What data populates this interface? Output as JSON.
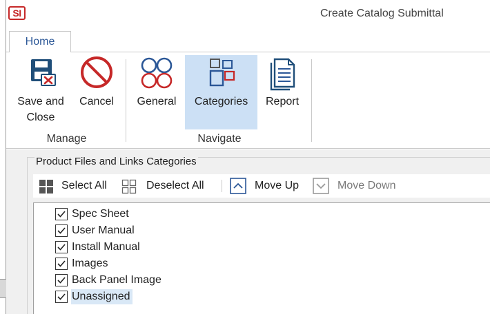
{
  "app": {
    "logo_text": "SI",
    "title": "Create Catalog Submittal"
  },
  "ribbon": {
    "tabs": [
      {
        "label": "Home"
      }
    ],
    "groups": {
      "manage": {
        "label": "Manage",
        "buttons": {
          "save_close": {
            "line1": "Save and",
            "line2": "Close"
          },
          "cancel": {
            "label": "Cancel"
          }
        }
      },
      "navigate": {
        "label": "Navigate",
        "buttons": {
          "general": {
            "label": "General"
          },
          "categories": {
            "label": "Categories"
          },
          "report": {
            "label": "Report"
          }
        }
      }
    }
  },
  "panel": {
    "title": "Product Files and Links Categories",
    "toolbar": {
      "select_all": "Select All",
      "deselect_all": "Deselect All",
      "move_up": "Move Up",
      "move_down": "Move Down"
    },
    "items": [
      {
        "label": "Spec Sheet",
        "checked": true
      },
      {
        "label": "User Manual",
        "checked": true
      },
      {
        "label": "Install Manual",
        "checked": true
      },
      {
        "label": "Images",
        "checked": true
      },
      {
        "label": "Back Panel Image",
        "checked": true
      },
      {
        "label": "Unassigned",
        "checked": true,
        "selected": true
      }
    ]
  },
  "colors": {
    "accent": "#2b5797",
    "cancel_red": "#c62828",
    "active_button_bg": "#cce0f5",
    "selection_bg": "#d9e8f6"
  }
}
